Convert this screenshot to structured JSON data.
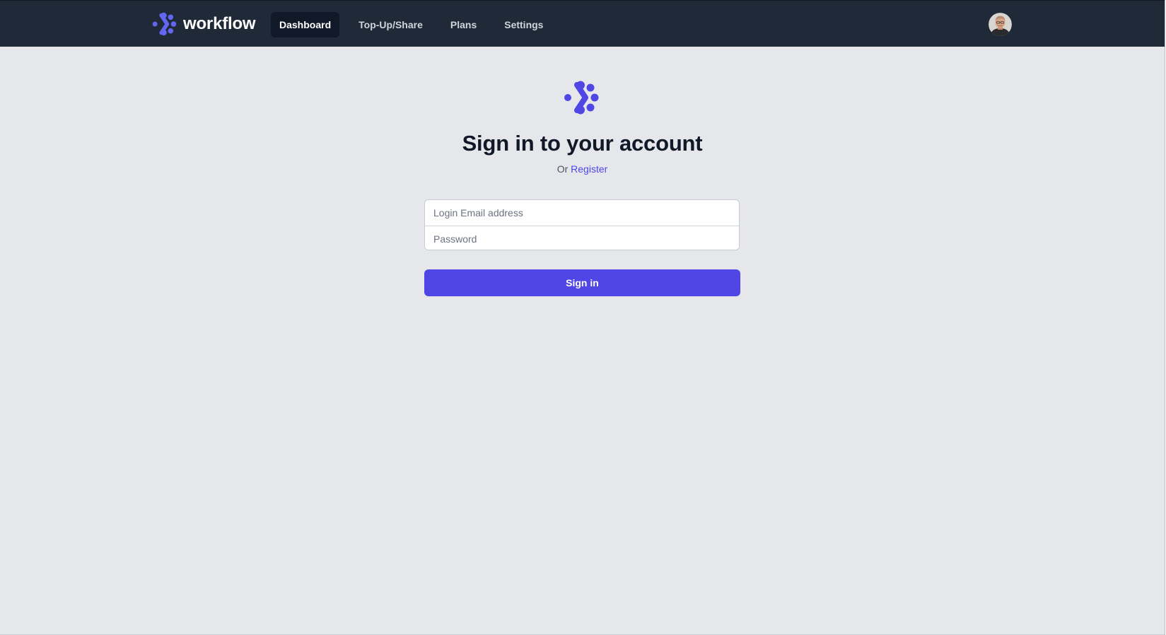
{
  "navbar": {
    "brand_name": "workflow",
    "links": [
      {
        "label": "Dashboard",
        "active": true
      },
      {
        "label": "Top-Up/Share",
        "active": false
      },
      {
        "label": "Plans",
        "active": false
      },
      {
        "label": "Settings",
        "active": false
      }
    ],
    "avatar_icon": "user-avatar"
  },
  "login": {
    "logo_icon": "workflow-logo-icon",
    "title": "Sign in to your account",
    "subtitle_prefix": "Or",
    "register_link": "Register",
    "email_placeholder": "Login Email address",
    "email_value": "",
    "password_placeholder": "Password",
    "password_value": "",
    "submit_label": "Sign in"
  },
  "colors": {
    "navbar_bg": "#1f2937",
    "page_bg": "#e5e7eb",
    "accent": "#4f46e5",
    "title_text": "#111827"
  }
}
